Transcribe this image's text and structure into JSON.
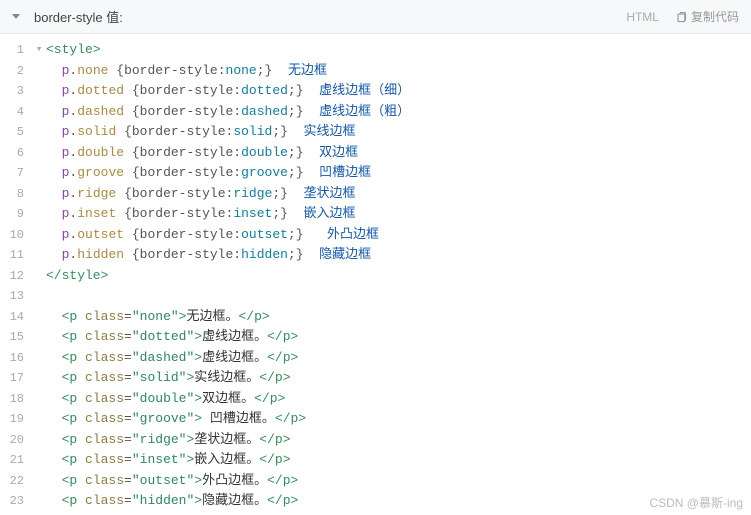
{
  "header": {
    "title": "border-style 值:",
    "lang": "HTML",
    "copy_label": "复制代码"
  },
  "lines": {
    "l1": {
      "tag_open": "<",
      "tag_name": "style",
      "tag_close": ">"
    },
    "rules": [
      {
        "sel": "p",
        "cls": "none",
        "prop": "border-style",
        "val": "none",
        "cmt": "无边框"
      },
      {
        "sel": "p",
        "cls": "dotted",
        "prop": "border-style",
        "val": "dotted",
        "cmt": "虚线边框（细）"
      },
      {
        "sel": "p",
        "cls": "dashed",
        "prop": "border-style",
        "val": "dashed",
        "cmt": "虚线边框（粗）"
      },
      {
        "sel": "p",
        "cls": "solid",
        "prop": "border-style",
        "val": "solid",
        "cmt": "实线边框"
      },
      {
        "sel": "p",
        "cls": "double",
        "prop": "border-style",
        "val": "double",
        "cmt": "双边框"
      },
      {
        "sel": "p",
        "cls": "groove",
        "prop": "border-style",
        "val": "groove",
        "cmt": "凹槽边框"
      },
      {
        "sel": "p",
        "cls": "ridge",
        "prop": "border-style",
        "val": "ridge",
        "cmt": "垄状边框"
      },
      {
        "sel": "p",
        "cls": "inset",
        "prop": "border-style",
        "val": "inset",
        "cmt": "嵌入边框"
      },
      {
        "sel": "p",
        "cls": "outset",
        "prop": "border-style",
        "val": "outset",
        "cmt": "外凸边框"
      },
      {
        "sel": "p",
        "cls": "hidden",
        "prop": "border-style",
        "val": "hidden",
        "cmt": "隐藏边框"
      }
    ],
    "l12": {
      "tag_open": "</",
      "tag_name": "style",
      "tag_close": ">"
    },
    "ptags": [
      {
        "cls": "none",
        "txt": "无边框。"
      },
      {
        "cls": "dotted",
        "txt": "虚线边框。"
      },
      {
        "cls": "dashed",
        "txt": "虚线边框。"
      },
      {
        "cls": "solid",
        "txt": "实线边框。"
      },
      {
        "cls": "double",
        "txt": "双边框。"
      },
      {
        "cls": "groove",
        "txt": " 凹槽边框。"
      },
      {
        "cls": "ridge",
        "txt": "垄状边框。"
      },
      {
        "cls": "inset",
        "txt": "嵌入边框。"
      },
      {
        "cls": "outset",
        "txt": "外凸边框。"
      },
      {
        "cls": "hidden",
        "txt": "隐藏边框。"
      }
    ]
  },
  "watermark": "CSDN @慕斯-ing"
}
